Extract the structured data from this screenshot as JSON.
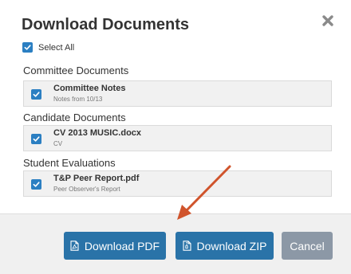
{
  "modal": {
    "title": "Download Documents",
    "close_icon": "close-icon",
    "select_all_label": "Select All",
    "select_all_checked": true
  },
  "sections": [
    {
      "title": "Committee Documents",
      "items": [
        {
          "name": "Committee Notes",
          "subtitle": "Notes from 10/13",
          "checked": true
        }
      ]
    },
    {
      "title": "Candidate Documents",
      "items": [
        {
          "name": "CV 2013 MUSIC.docx",
          "subtitle": "CV",
          "checked": true
        }
      ]
    },
    {
      "title": "Student Evaluations",
      "items": [
        {
          "name": "T&P Peer Report.pdf",
          "subtitle": "Peer Observer's Report",
          "checked": true
        }
      ]
    }
  ],
  "footer": {
    "download_pdf_label": "Download PDF",
    "download_pdf_icon": "pdf-file-icon",
    "download_zip_label": "Download ZIP",
    "download_zip_icon": "zip-file-icon",
    "cancel_label": "Cancel"
  },
  "colors": {
    "primary": "#2a73a8",
    "checkbox": "#2b7fc2",
    "cancel": "#8c98a6",
    "annotation_arrow": "#d0542c"
  }
}
